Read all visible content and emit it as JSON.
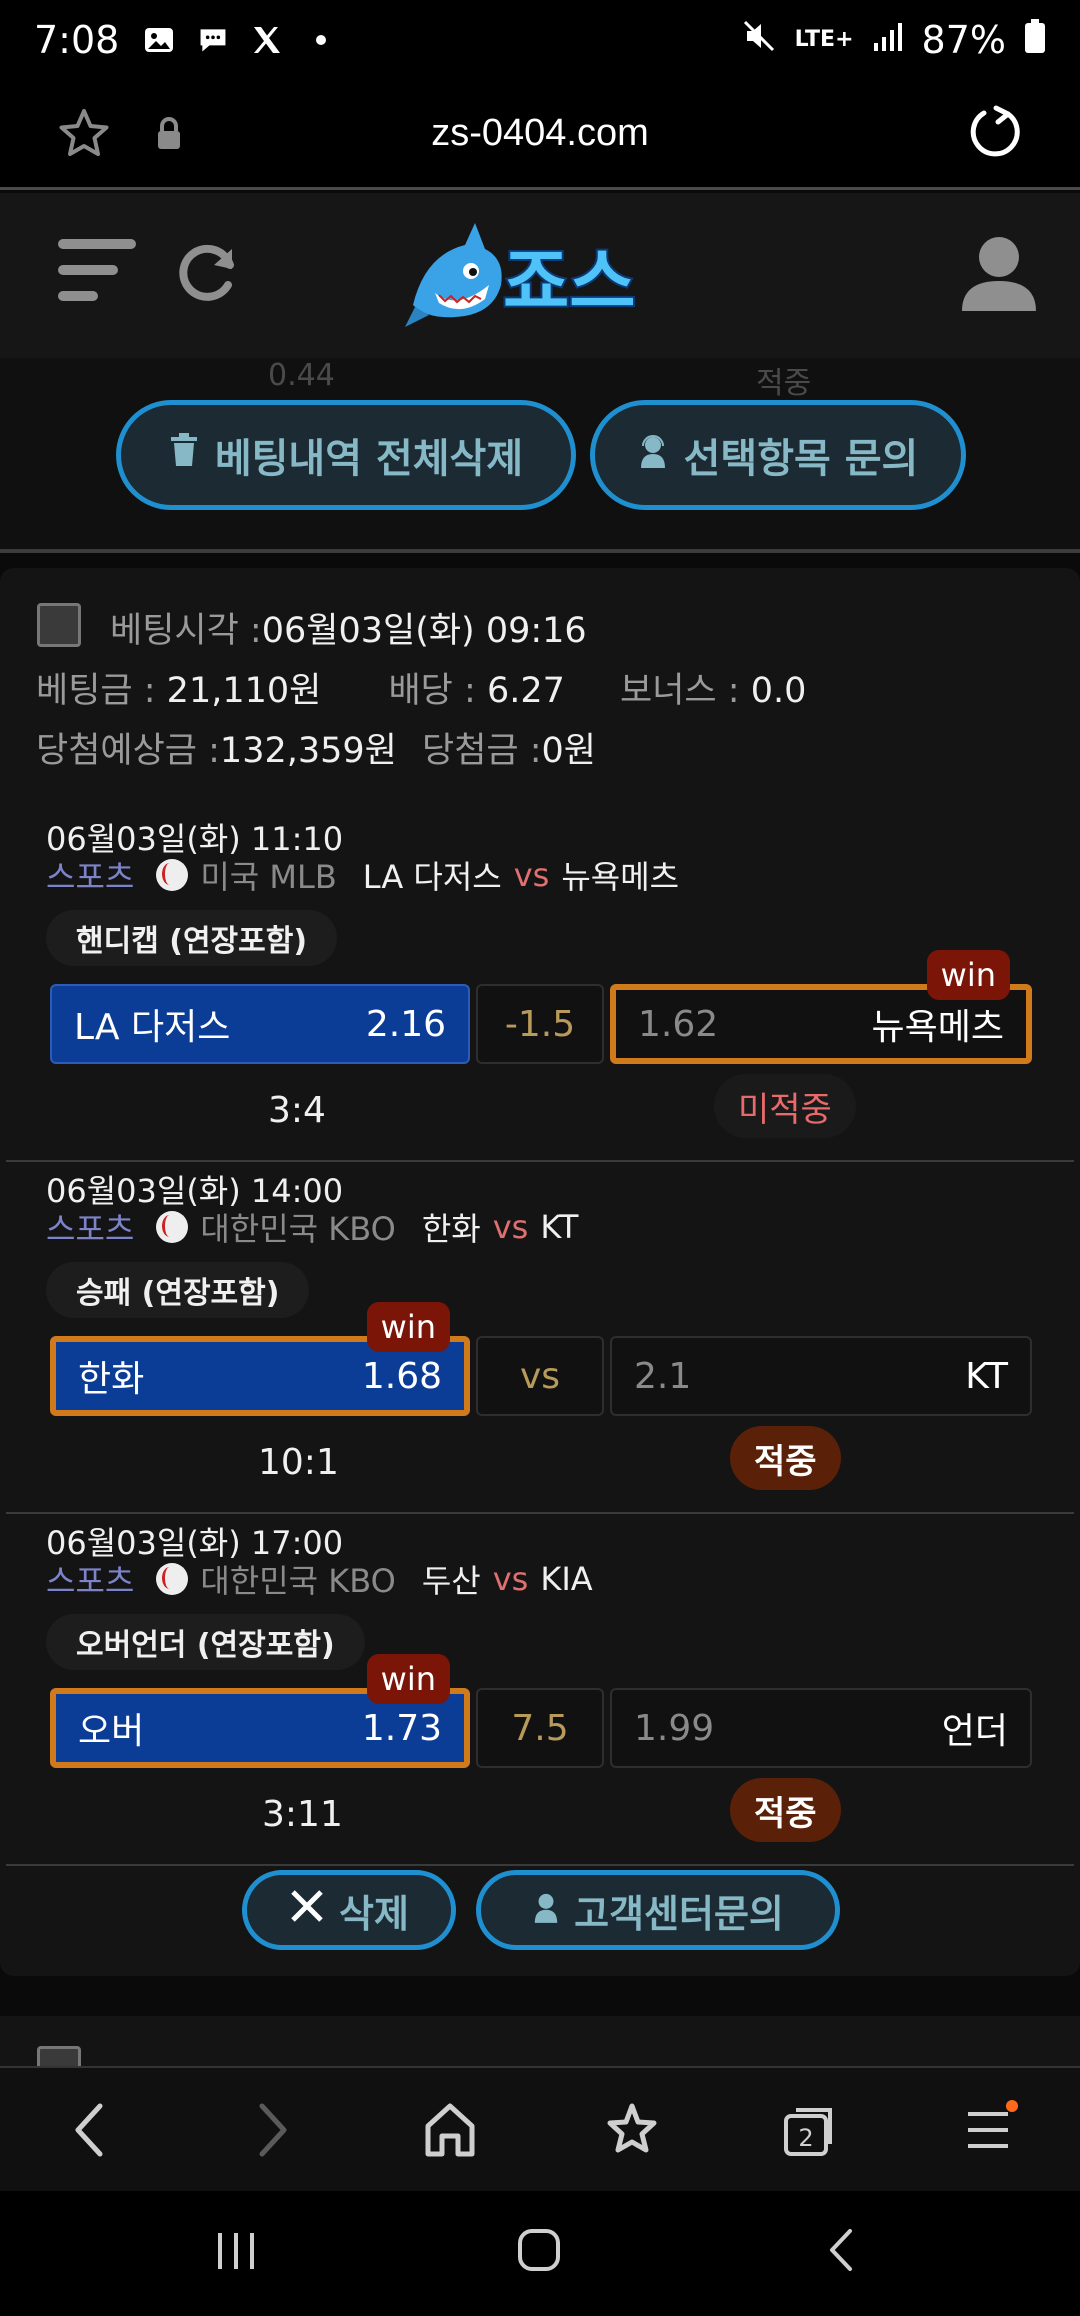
{
  "status": {
    "time": "7:08",
    "network": "LTE+",
    "battery": "87%"
  },
  "browser": {
    "url": "zs-0404.com"
  },
  "site": {
    "logo_text": "죠스"
  },
  "top_buttons": {
    "delete_all": "베팅내역 전체삭제",
    "inquiry_selected": "선택항목 문의",
    "hidden_left": "0.44",
    "hidden_right": "적중"
  },
  "bet": {
    "time_label": "베팅시각 :",
    "time_value": "06월03일(화) 09:16",
    "amount_label": "베팅금 :",
    "amount_value": "21,110원",
    "odds_label": "배당 :",
    "odds_value": "6.27",
    "bonus_label": "보너스 :",
    "bonus_value": "0.0",
    "expected_label": "당첨예상금 :",
    "expected_value": "132,359원",
    "won_label": "당첨금 :",
    "won_value": "0원"
  },
  "games": [
    {
      "datetime": "06월03일(화) 11:10",
      "sport": "스포츠",
      "league": "미국 MLB",
      "home": "LA 다저스",
      "vs": "vs",
      "away": "뉴욕메츠",
      "market": "핸디캡 (연장포함)",
      "home_odds": "2.16",
      "line": "-1.5",
      "away_odds": "1.62",
      "score": "3:4",
      "result": "미적중",
      "win_badge": "win"
    },
    {
      "datetime": "06월03일(화) 14:00",
      "sport": "스포츠",
      "league": "대한민국 KBO",
      "home": "한화",
      "vs": "vs",
      "away": "KT",
      "market": "승패 (연장포함)",
      "home_odds": "1.68",
      "line": "vs",
      "away_odds": "2.1",
      "score": "10:1",
      "result": "적중",
      "win_badge": "win"
    },
    {
      "datetime": "06월03일(화) 17:00",
      "sport": "스포츠",
      "league": "대한민국 KBO",
      "home": "두산",
      "vs": "vs",
      "away": "KIA",
      "market": "오버언더 (연장포함)",
      "home_label": "오버",
      "home_odds": "1.73",
      "line": "7.5",
      "away_odds": "1.99",
      "away_label": "언더",
      "score": "3:11",
      "result": "적중",
      "win_badge": "win"
    }
  ],
  "bottom_buttons": {
    "delete": "삭제",
    "support": "고객센터문의"
  },
  "tabs_count": "2",
  "colors": {
    "accent_blue": "#1f8fd0",
    "selection_orange": "#d07a1c",
    "home_blue": "#0c3d96",
    "win_red": "#7a1508"
  }
}
